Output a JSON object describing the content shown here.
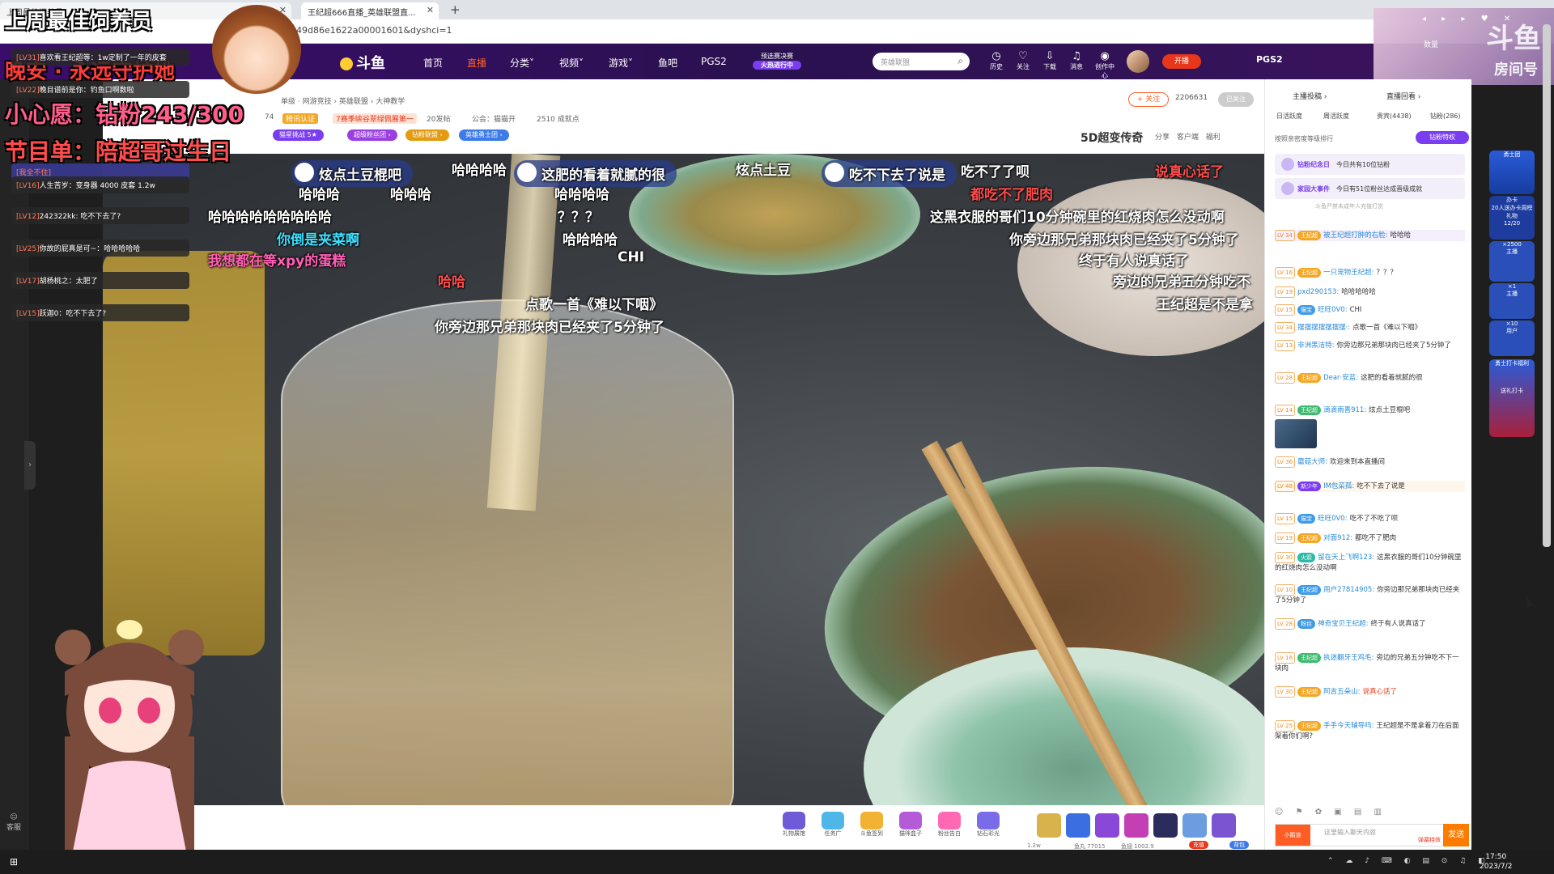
{
  "browser": {
    "tabs": [
      {
        "label": "上周最佳饲养员",
        "active": false
      },
      {
        "label": "王纪超666直播_英雄联盟直...",
        "active": true
      }
    ],
    "address": "1149d86e1622a00001601&dyshci=1"
  },
  "site": {
    "logo": "斗鱼",
    "nav": [
      "首页",
      "直播",
      "分类˅",
      "视频˅",
      "游戏˅",
      "鱼吧",
      "PGS2"
    ],
    "active_nav": "直播",
    "promo_line1": "预选赛决赛",
    "promo_line2": "火热进行中",
    "search_placeholder": "英雄联盟",
    "header_icons": [
      {
        "name": "history-icon",
        "glyph": "◷",
        "label": "历史"
      },
      {
        "name": "heart-icon",
        "glyph": "♡",
        "label": "关注"
      },
      {
        "name": "download-icon",
        "glyph": "⇩",
        "label": "下载"
      },
      {
        "name": "bell-icon",
        "glyph": "🔔",
        "label": "消息"
      },
      {
        "name": "creator-icon",
        "glyph": "◉",
        "label": "创作中心"
      }
    ],
    "kaibo": "开播",
    "pgs2": "PGS2",
    "corner_logo": "斗鱼",
    "corner_sub": "房间号",
    "corner_label": "数量"
  },
  "overlay": {
    "line1": "上周最佳饲养员",
    "line2": "晚安 · 永远守护她",
    "line3": "小心愿：钻粉243/300",
    "line4": "节目单：陪超哥过生日",
    "left_chat": [
      {
        "name": "[LV31]",
        "text": "喜欢看王纪超等：1w定制了一年的皮套"
      },
      {
        "name": "[LV22]",
        "text": "晚目谱前是你：钓鱼口啊数啦"
      },
      {
        "name": "[我全不住]",
        "text": ""
      },
      {
        "name": "[LV16]",
        "text": "人生苦岁：变身器 4000 皮套 1.2w"
      },
      {
        "name": "[LV12]",
        "text": "242322kk: 吃不下去了?"
      },
      {
        "name": "[LV25]",
        "text": "你故的屁真是可~：哈哈哈哈哈"
      },
      {
        "name": "[LV17]",
        "text": "胡杨桃之：太肥了"
      },
      {
        "name": "[LV15]",
        "text": "跃迦0：吃不下去了?"
      }
    ],
    "kefu": "客服"
  },
  "stream": {
    "crumb": "单级 · 网游竞技 › 英雄联盟 › 大神教学",
    "stats": [
      "74",
      "腾讯认证",
      "7赛季峡谷翠绿佩展第一",
      "20发帖",
      "公会：猫猫开",
      "2510 成就点"
    ],
    "pills": [
      "猫星挑战 5★",
      "超级粉丝团 ›",
      "钻粉联盟 ›",
      "英雄勇士团 ›"
    ],
    "follow": "+ 关注",
    "fans": "2206631",
    "followed_tag": "已关注",
    "title_5d": "5D超变传奇",
    "share_tools": "分享 客户端 福利"
  },
  "danmu": [
    {
      "text": "炫点土豆棍吧",
      "style": "bubble"
    },
    {
      "text": "这肥的看着就腻的很",
      "style": "bubble"
    },
    {
      "text": "吃不下去了说是",
      "style": "bubble"
    },
    {
      "text": "哈哈哈哈",
      "style": "white"
    },
    {
      "text": "炫点土豆",
      "style": "white"
    },
    {
      "text": "吃不了了呗",
      "style": "white"
    },
    {
      "text": "说真心话了",
      "style": "red"
    },
    {
      "text": "哈哈哈",
      "style": "white"
    },
    {
      "text": "哈哈哈",
      "style": "white"
    },
    {
      "text": "哈哈哈哈",
      "style": "white"
    },
    {
      "text": "都吃不了肥肉",
      "style": "red"
    },
    {
      "text": "哈哈哈哈哈哈哈哈哈",
      "style": "white"
    },
    {
      "text": "？？？",
      "style": "white"
    },
    {
      "text": "这黑衣服的哥们10分钟碗里的红烧肉怎么没动啊",
      "style": "white"
    },
    {
      "text": "你倒是夹菜啊",
      "style": "cyan"
    },
    {
      "text": "哈哈哈哈",
      "style": "white"
    },
    {
      "text": "你旁边那兄弟那块肉已经夹了5分钟了",
      "style": "white"
    },
    {
      "text": "我想都在等xpy的蛋糕",
      "style": "pink"
    },
    {
      "text": "CHI",
      "style": "white"
    },
    {
      "text": "终于有人说真话了",
      "style": "white"
    },
    {
      "text": "哈哈",
      "style": "red"
    },
    {
      "text": "旁边的兄弟五分钟吃不",
      "style": "white"
    },
    {
      "text": "点歌一首《难以下咽》",
      "style": "white"
    },
    {
      "text": "王纪超是不是拿",
      "style": "white"
    },
    {
      "text": "你旁边那兄弟那块肉已经夹了5分钟了",
      "style": "white"
    }
  ],
  "gifts": [
    {
      "label": "礼物展馆",
      "color": "#6f5ad8"
    },
    {
      "label": "任务广",
      "color": "#4fb7e8"
    },
    {
      "label": "斗鱼签到",
      "color": "#f2b233"
    },
    {
      "label": "猫咪盒子",
      "color": "#b45bd8"
    },
    {
      "label": "粉丝告白",
      "color": "#ff69b4"
    },
    {
      "label": "钻石彩光",
      "color": "#7a6be8"
    }
  ],
  "gift_squares": [
    "#d8b24a",
    "#3b6ee0",
    "#8a47d8",
    "#c43fb3",
    "#2b2b5c",
    "#6b9de0",
    "#7b55d1"
  ],
  "giftbar_footer": [
    "1.2w",
    "鱼丸 77015",
    "鱼翅 1002.9",
    "充值",
    "背包"
  ],
  "chat": {
    "tabs": [
      "主播投稿 ›",
      "直播回看 ›"
    ],
    "rank_tabs": [
      "日活跃度",
      "周活跃度",
      "贵宾(4438)",
      "钻粉(286)"
    ],
    "rank_desc": "按照亲密度等级排行",
    "rank_btn": "钻粉特权",
    "notices": [
      {
        "title": "钻粉纪念日",
        "text": "今日共有10位钻粉"
      },
      {
        "title": "家园大事件",
        "text": "今日有51位粉丝达成晋级成就"
      }
    ],
    "minor_notice": "斗鱼严禁未成年人充值打赏",
    "messages": [
      {
        "lv": "LV 34",
        "name": "被王纪超打肿的右脸:",
        "text": "哈哈哈"
      },
      {
        "lv": "LV 16",
        "name": "一只宠物王纪超:",
        "text": "？？？"
      },
      {
        "lv": "LV 19",
        "name": "pxd290153:",
        "text": "哈哈哈哈哈"
      },
      {
        "lv": "LV 15",
        "name": "旺旺0V0:",
        "text": "CHI"
      },
      {
        "lv": "LV 34",
        "name": "摆摆摆摆摆摆摆·:",
        "text": "点歌一首《难以下咽》"
      },
      {
        "lv": "LV 13",
        "name": "非洲黑洁特:",
        "text": "你旁边那兄弟那块肉已经夹了5分钟了"
      },
      {
        "lv": "LV 28",
        "name": "Dear·安蓝:",
        "text": "这肥的看着就腻的很"
      },
      {
        "lv": "LV 14",
        "name": "滴滴雨喜911:",
        "text": "炫点土豆棍吧"
      },
      {
        "lv": "LV 36",
        "name": "蘑菇大师:",
        "text": "欢迎来到本直播间"
      },
      {
        "lv": "LV 48",
        "name": "IM包菜孤:",
        "text": "吃不下去了说是"
      },
      {
        "lv": "LV 15",
        "name": "旺旺0V0:",
        "text": "吃不了不吃了呗"
      },
      {
        "lv": "LV 19",
        "name": "对面912:",
        "text": "都吃不了肥肉"
      },
      {
        "lv": "LV 30",
        "name": "留在天上飞啊123:",
        "text": "这黑衣服的哥们10分钟碗里的红烧肉怎么没动啊"
      },
      {
        "lv": "LV 10",
        "name": "用户27814905:",
        "text": "你旁边那兄弟那块肉已经夹了5分钟了"
      },
      {
        "lv": "LV 28",
        "name": "神奇宝贝王纪超:",
        "text": "终于有人说真话了"
      },
      {
        "lv": "LV 16",
        "name": "执迷翻牙王鸡毛:",
        "text": "旁边的兄弟五分钟吃不下一块肉"
      },
      {
        "lv": "LV 30",
        "name": "阿吉五朵山:",
        "text": "说真心话了"
      },
      {
        "lv": "LV 25",
        "name": "手手今天辅导吗:",
        "text": "王纪超是不是拿着刀在后面架着你们啊?"
      }
    ],
    "input_placeholder": "这里输入聊天内容",
    "send": "发送",
    "input_sub": "小鹅道",
    "input_label": "弹幕特效"
  },
  "right_float": [
    "勇士团",
    "办卡",
    "20人送办卡周榜礼物",
    "12/20",
    "×2500",
    "主播",
    "×1",
    "主播",
    "×10",
    "用户",
    "勇士打卡福利",
    "送礼打卡"
  ],
  "taskbar": {
    "time": "17:50",
    "date": "2023/7/2"
  },
  "colors": {
    "brand": "#ff5d23",
    "header_bg": "#2a1150",
    "accent_purple": "#7a3df0"
  }
}
